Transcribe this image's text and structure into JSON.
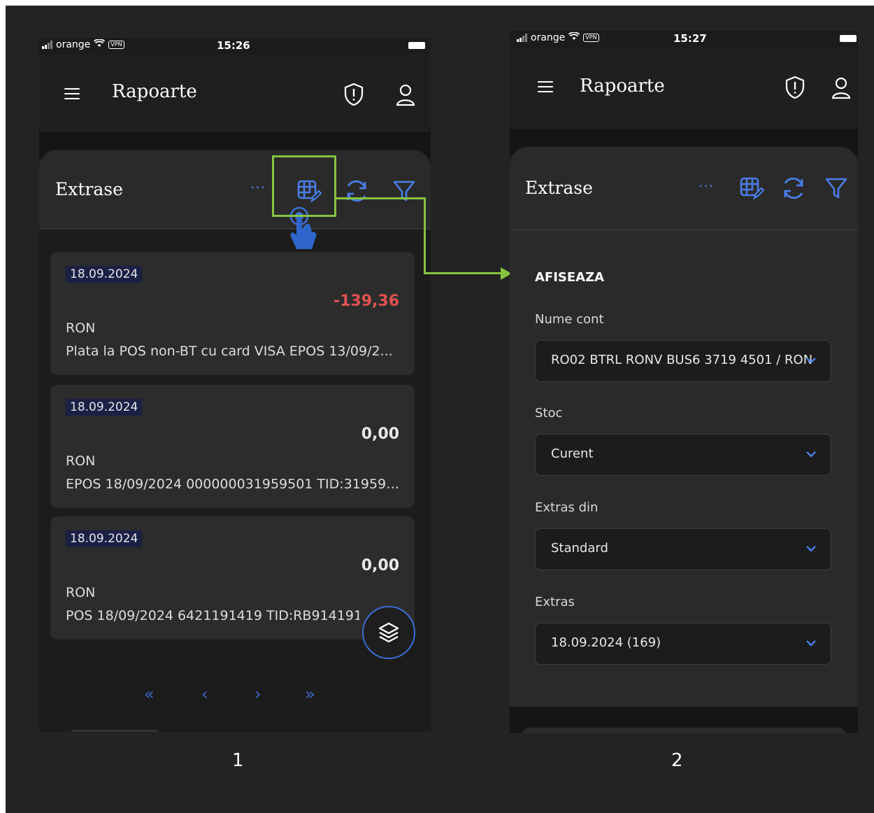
{
  "screen1": {
    "status": {
      "carrier": "orange",
      "vpn": "VPN",
      "time": "15:26"
    },
    "app_title": "Rapoarte",
    "section_title": "Extrase",
    "more_label": "···",
    "transactions": [
      {
        "date": "18.09.2024",
        "amount": "-139,36",
        "negative": true,
        "currency": "RON",
        "description": "Plata la POS non-BT cu card VISA EPOS 13/09/2..."
      },
      {
        "date": "18.09.2024",
        "amount": "0,00",
        "negative": false,
        "currency": "RON",
        "description": "EPOS 18/09/2024 000000031959501 TID:319595..."
      },
      {
        "date": "18.09.2024",
        "amount": "0,00",
        "negative": false,
        "currency": "RON",
        "description": "POS 18/09/2024 6421191419 TID:RB914191 I..."
      }
    ],
    "pagination": {
      "first": "«",
      "prev": "‹",
      "next": "›",
      "last": "»"
    },
    "caption": "1"
  },
  "screen2": {
    "status": {
      "carrier": "orange",
      "vpn": "VPN",
      "time": "15:27"
    },
    "app_title": "Rapoarte",
    "section_title": "Extrase",
    "more_label": "···",
    "panel_heading": "AFISEAZA",
    "fields": [
      {
        "label": "Nume cont",
        "value": "RO02 BTRL RONV BUS6 3719 4501 / RON"
      },
      {
        "label": "Stoc",
        "value": "Curent"
      },
      {
        "label": "Extras din",
        "value": "Standard"
      },
      {
        "label": "Extras",
        "value": "18.09.2024 (169)"
      }
    ],
    "caption": "2"
  },
  "colors": {
    "accent": "#4a7ee6",
    "negative": "#e05252",
    "highlight": "#86c440",
    "background": "#232323"
  },
  "icons": [
    "menu-icon",
    "shield-icon",
    "user-icon",
    "more-icon",
    "table-edit-icon",
    "refresh-icon",
    "filter-icon",
    "layers-icon",
    "tap-hand-icon",
    "chevron-down-icon"
  ]
}
